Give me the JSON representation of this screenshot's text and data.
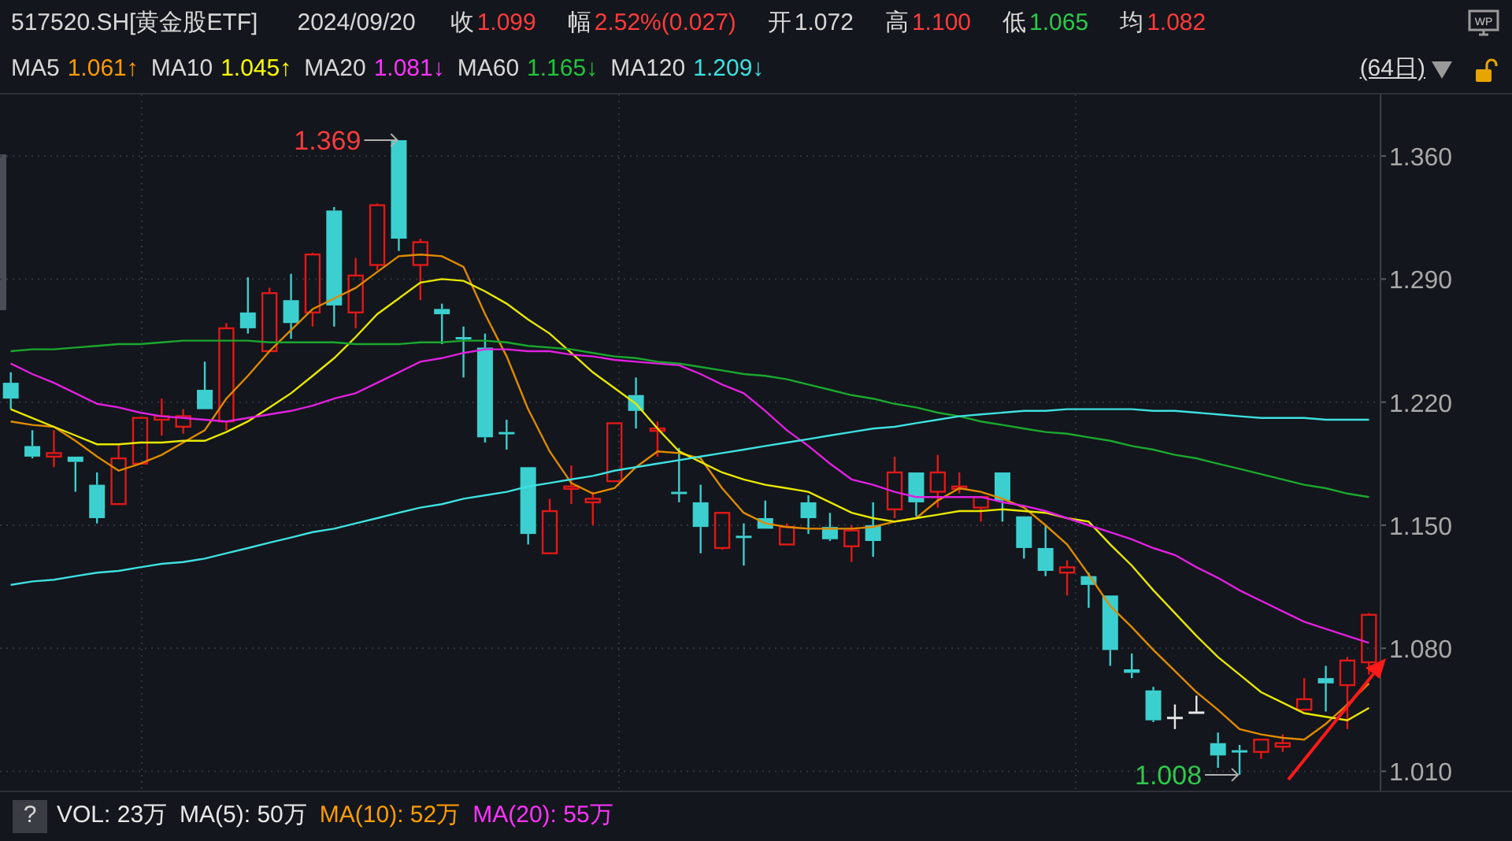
{
  "header": {
    "code": "517520.SH[黄金股ETF]",
    "date": "2024/09/20",
    "quotes": [
      {
        "label": "收",
        "value": "1.099",
        "color": "#ff3b3b"
      },
      {
        "label": "幅",
        "value": "2.52%(0.027)",
        "color": "#ff3b3b"
      },
      {
        "label": "开",
        "value": "1.072",
        "color": "#d8d8d8"
      },
      {
        "label": "高",
        "value": "1.100",
        "color": "#ff3b3b"
      },
      {
        "label": "低",
        "value": "1.065",
        "color": "#2ec84a"
      },
      {
        "label": "均",
        "value": "1.082",
        "color": "#ff3b3b"
      }
    ],
    "monitor_label": "WP"
  },
  "ma_legend": [
    {
      "value": "1.061↑",
      "color": "#ff9c00"
    },
    {
      "value": "1.045↑",
      "color": "#ffff00"
    },
    {
      "value": "1.081↓",
      "color": "#ff33ff"
    },
    {
      "value": "1.165↓",
      "color": "#22c43a"
    },
    {
      "value": "1.209↓",
      "color": "#3ee0e0"
    }
  ],
  "period": "(64日)",
  "chart_data": {
    "type": "candlestick",
    "grid": true,
    "ylim": [
      0.999,
      1.395
    ],
    "ohlc": [
      [
        1.231,
        1.237,
        1.216,
        1.222
      ],
      [
        1.195,
        1.204,
        1.188,
        1.189
      ],
      [
        1.189,
        1.204,
        1.183,
        1.191
      ],
      [
        1.189,
        1.189,
        1.169,
        1.186
      ],
      [
        1.173,
        1.18,
        1.151,
        1.154
      ],
      [
        1.162,
        1.196,
        1.162,
        1.188
      ],
      [
        1.185,
        1.211,
        1.185,
        1.211
      ],
      [
        1.21,
        1.222,
        1.201,
        1.212
      ],
      [
        1.206,
        1.216,
        1.202,
        1.212
      ],
      [
        1.227,
        1.243,
        1.216,
        1.216
      ],
      [
        1.209,
        1.265,
        1.204,
        1.262
      ],
      [
        1.271,
        1.291,
        1.259,
        1.262
      ],
      [
        1.249,
        1.285,
        1.249,
        1.282
      ],
      [
        1.278,
        1.293,
        1.256,
        1.265
      ],
      [
        1.271,
        1.305,
        1.263,
        1.304
      ],
      [
        1.329,
        1.331,
        1.263,
        1.275
      ],
      [
        1.271,
        1.302,
        1.262,
        1.292
      ],
      [
        1.298,
        1.333,
        1.295,
        1.332
      ],
      [
        1.369,
        1.369,
        1.306,
        1.313
      ],
      [
        1.298,
        1.313,
        1.278,
        1.311
      ],
      [
        1.273,
        1.276,
        1.253,
        1.27
      ],
      [
        1.257,
        1.263,
        1.234,
        1.256
      ],
      [
        1.251,
        1.259,
        1.197,
        1.2
      ],
      [
        1.203,
        1.21,
        1.193,
        1.202
      ],
      [
        1.183,
        1.183,
        1.139,
        1.145
      ],
      [
        1.134,
        1.165,
        1.134,
        1.158
      ],
      [
        1.171,
        1.184,
        1.162,
        1.172
      ],
      [
        1.163,
        1.169,
        1.15,
        1.165
      ],
      [
        1.175,
        1.208,
        1.175,
        1.208
      ],
      [
        1.224,
        1.234,
        1.205,
        1.215
      ],
      [
        1.204,
        1.209,
        1.189,
        1.205
      ],
      [
        1.169,
        1.194,
        1.163,
        1.168
      ],
      [
        1.163,
        1.173,
        1.134,
        1.149
      ],
      [
        1.137,
        1.157,
        1.136,
        1.157
      ],
      [
        1.144,
        1.151,
        1.127,
        1.143
      ],
      [
        1.154,
        1.164,
        1.148,
        1.148
      ],
      [
        1.139,
        1.151,
        1.139,
        1.149
      ],
      [
        1.163,
        1.167,
        1.145,
        1.154
      ],
      [
        1.149,
        1.157,
        1.141,
        1.142
      ],
      [
        1.138,
        1.15,
        1.129,
        1.147
      ],
      [
        1.15,
        1.163,
        1.132,
        1.141
      ],
      [
        1.159,
        1.189,
        1.154,
        1.18
      ],
      [
        1.18,
        1.18,
        1.155,
        1.163
      ],
      [
        1.169,
        1.19,
        1.16,
        1.18
      ],
      [
        1.171,
        1.18,
        1.168,
        1.172
      ],
      [
        1.16,
        1.166,
        1.152,
        1.166
      ],
      [
        1.18,
        1.18,
        1.152,
        1.164
      ],
      [
        1.155,
        1.155,
        1.131,
        1.137
      ],
      [
        1.137,
        1.15,
        1.121,
        1.124
      ],
      [
        1.123,
        1.13,
        1.11,
        1.126
      ],
      [
        1.121,
        1.123,
        1.103,
        1.116
      ],
      [
        1.11,
        1.11,
        1.07,
        1.079
      ],
      [
        1.068,
        1.077,
        1.063,
        1.066
      ],
      [
        1.056,
        1.058,
        1.038,
        1.039
      ],
      [
        1.041,
        1.048,
        1.034,
        1.041
      ],
      [
        1.044,
        1.053,
        1.043,
        1.044
      ],
      [
        1.026,
        1.032,
        1.012,
        1.019
      ],
      [
        1.022,
        1.025,
        1.008,
        1.021
      ],
      [
        1.021,
        1.028,
        1.017,
        1.028
      ],
      [
        1.024,
        1.031,
        1.021,
        1.026
      ],
      [
        1.045,
        1.063,
        1.045,
        1.051
      ],
      [
        1.063,
        1.07,
        1.044,
        1.06
      ],
      [
        1.059,
        1.075,
        1.034,
        1.073
      ],
      [
        1.072,
        1.1,
        1.065,
        1.099
      ]
    ],
    "yticks": [
      {
        "value": 1.01,
        "label": "1.010"
      },
      {
        "value": 1.08,
        "label": "1.080"
      },
      {
        "value": 1.15,
        "label": "1.150"
      },
      {
        "value": 1.22,
        "label": "1.220"
      },
      {
        "value": 1.29,
        "label": "1.290"
      },
      {
        "value": 1.36,
        "label": "1.360"
      }
    ],
    "categories": [
      null,
      null,
      null,
      null,
      null,
      null,
      null,
      null,
      null,
      null,
      null,
      null,
      null,
      null,
      null,
      null,
      null,
      null,
      null,
      null,
      null,
      null,
      null,
      null,
      null,
      null,
      null,
      null,
      null,
      null,
      null,
      null,
      null,
      null,
      null,
      null,
      null,
      null,
      null,
      null,
      null,
      null,
      null,
      null,
      null,
      null,
      null,
      null,
      null,
      null,
      null,
      null,
      null,
      null,
      null,
      null,
      null,
      null,
      null,
      null,
      null,
      null,
      null,
      null
    ],
    "series": [
      {
        "name": "MA5",
        "type": "line",
        "color": "#e08a00",
        "values": [
          1.209,
          1.207,
          1.206,
          1.198,
          1.189,
          1.181,
          1.185,
          1.19,
          1.197,
          1.204,
          1.222,
          1.235,
          1.249,
          1.261,
          1.273,
          1.279,
          1.285,
          1.294,
          1.303,
          1.304,
          1.303,
          1.297,
          1.27,
          1.246,
          1.216,
          1.192,
          1.174,
          1.168,
          1.171,
          1.183,
          1.192,
          1.191,
          1.188,
          1.171,
          1.157,
          1.151,
          1.149,
          1.148,
          1.148,
          1.148,
          1.149,
          1.152,
          1.154,
          1.164,
          1.171,
          1.169,
          1.165,
          1.16,
          1.15,
          1.139,
          1.122,
          1.104,
          1.092,
          1.079,
          1.067,
          1.055,
          1.045,
          1.034,
          1.031,
          1.029,
          1.028,
          1.037,
          1.048,
          1.06
        ]
      },
      {
        "name": "MA10",
        "type": "line",
        "color": "#e8e800",
        "values": [
          1.216,
          1.211,
          1.206,
          1.201,
          1.196,
          1.196,
          1.197,
          1.197,
          1.198,
          1.198,
          1.203,
          1.209,
          1.217,
          1.225,
          1.235,
          1.245,
          1.257,
          1.27,
          1.279,
          1.288,
          1.29,
          1.289,
          1.283,
          1.276,
          1.267,
          1.259,
          1.248,
          1.237,
          1.228,
          1.219,
          1.205,
          1.192,
          1.186,
          1.18,
          1.176,
          1.173,
          1.171,
          1.169,
          1.163,
          1.157,
          1.154,
          1.152,
          1.154,
          1.156,
          1.158,
          1.158,
          1.159,
          1.158,
          1.157,
          1.154,
          1.152,
          1.139,
          1.127,
          1.113,
          1.1,
          1.087,
          1.075,
          1.065,
          1.055,
          1.049,
          1.043,
          1.041,
          1.039,
          1.046
        ]
      },
      {
        "name": "MA20",
        "type": "line",
        "color": "#e020e0",
        "values": [
          1.242,
          1.236,
          1.231,
          1.225,
          1.219,
          1.217,
          1.214,
          1.212,
          1.211,
          1.21,
          1.209,
          1.211,
          1.213,
          1.215,
          1.218,
          1.222,
          1.225,
          1.231,
          1.237,
          1.243,
          1.245,
          1.248,
          1.25,
          1.25,
          1.249,
          1.249,
          1.247,
          1.246,
          1.244,
          1.243,
          1.242,
          1.241,
          1.236,
          1.23,
          1.225,
          1.215,
          1.204,
          1.195,
          1.185,
          1.176,
          1.173,
          1.169,
          1.166,
          1.166,
          1.166,
          1.166,
          1.163,
          1.161,
          1.158,
          1.154,
          1.15,
          1.146,
          1.142,
          1.137,
          1.133,
          1.126,
          1.12,
          1.113,
          1.107,
          1.101,
          1.095,
          1.091,
          1.087,
          1.083
        ]
      },
      {
        "name": "MA60",
        "type": "line",
        "color": "#1aa82e",
        "values": [
          1.249,
          1.25,
          1.25,
          1.251,
          1.252,
          1.253,
          1.253,
          1.254,
          1.255,
          1.255,
          1.255,
          1.255,
          1.254,
          1.254,
          1.254,
          1.254,
          1.253,
          1.253,
          1.253,
          1.254,
          1.254,
          1.255,
          1.255,
          1.254,
          1.252,
          1.251,
          1.25,
          1.248,
          1.246,
          1.245,
          1.243,
          1.242,
          1.24,
          1.238,
          1.236,
          1.235,
          1.233,
          1.23,
          1.227,
          1.224,
          1.222,
          1.219,
          1.217,
          1.214,
          1.212,
          1.209,
          1.207,
          1.205,
          1.203,
          1.202,
          1.2,
          1.198,
          1.195,
          1.193,
          1.19,
          1.188,
          1.185,
          1.182,
          1.179,
          1.176,
          1.173,
          1.171,
          1.168,
          1.166
        ]
      },
      {
        "name": "MA120",
        "type": "line",
        "color": "#3ee0e0",
        "values": [
          1.116,
          1.118,
          1.119,
          1.121,
          1.123,
          1.124,
          1.126,
          1.128,
          1.129,
          1.131,
          1.134,
          1.137,
          1.14,
          1.143,
          1.146,
          1.148,
          1.151,
          1.154,
          1.157,
          1.16,
          1.162,
          1.165,
          1.167,
          1.169,
          1.172,
          1.174,
          1.176,
          1.178,
          1.181,
          1.183,
          1.185,
          1.187,
          1.189,
          1.191,
          1.193,
          1.195,
          1.197,
          1.199,
          1.201,
          1.203,
          1.205,
          1.206,
          1.208,
          1.21,
          1.212,
          1.213,
          1.214,
          1.215,
          1.215,
          1.216,
          1.216,
          1.216,
          1.216,
          1.215,
          1.215,
          1.214,
          1.213,
          1.212,
          1.211,
          1.211,
          1.211,
          1.21,
          1.21,
          1.21
        ]
      }
    ],
    "annotations": [
      "1.369",
      "1.008"
    ]
  },
  "volume_legend": {
    "help": "?",
    "items": [
      {
        "text": "VOL: 23万",
        "color": "#e8e8e8"
      },
      {
        "text": "MA(5): 50万",
        "color": "#e8e8e8"
      },
      {
        "text": "MA(10): 52万",
        "color": "#ff9c00"
      },
      {
        "text": "MA(20): 55万",
        "color": "#ff33ff"
      }
    ]
  }
}
